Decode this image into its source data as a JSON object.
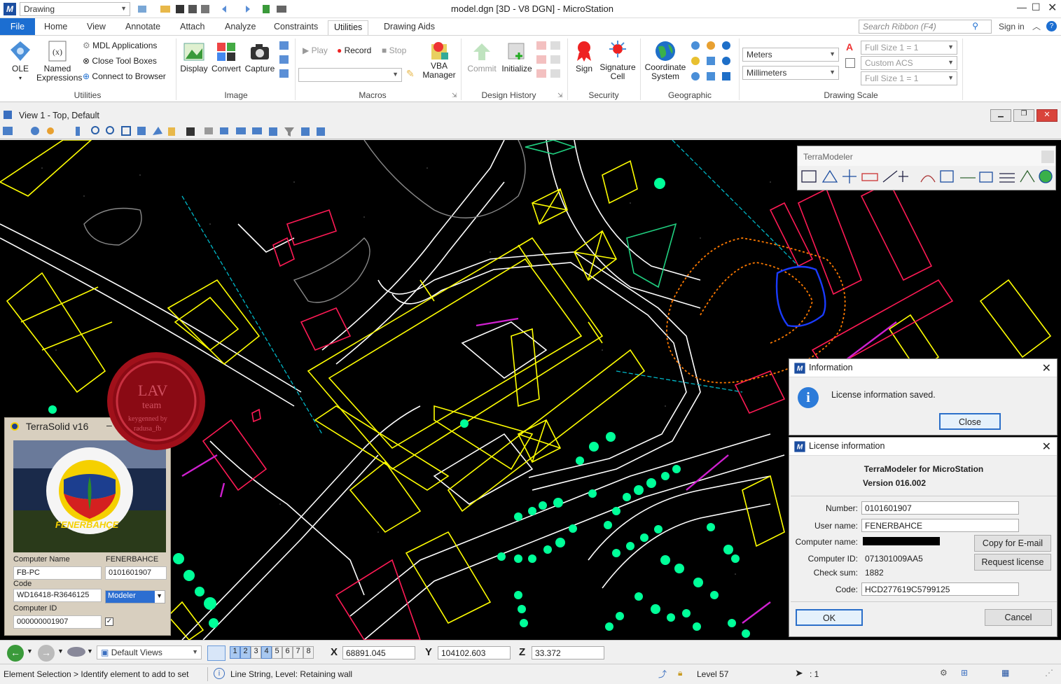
{
  "app": {
    "title": "model.dgn [3D - V8 DGN] - MicroStation",
    "workflow": "Drawing",
    "search_placeholder": "Search Ribbon (F4)",
    "sign_in": "Sign in"
  },
  "tabs": [
    "File",
    "Home",
    "View",
    "Annotate",
    "Attach",
    "Analyze",
    "Constraints",
    "Utilities",
    "Drawing Aids"
  ],
  "ribbon": {
    "utilities": {
      "ole": "OLE",
      "named": "Named",
      "expressions": "Expressions",
      "mdl": "MDL Applications",
      "close_tool": "Close Tool Boxes",
      "connect": "Connect to Browser",
      "label": "Utilities"
    },
    "image": {
      "display": "Display",
      "convert": "Convert",
      "capture": "Capture",
      "label": "Image"
    },
    "macros": {
      "play": "Play",
      "record": "Record",
      "stop": "Stop",
      "vba1": "VBA",
      "vba2": "Manager",
      "label": "Macros"
    },
    "design_history": {
      "commit": "Commit",
      "initialize": "Initialize",
      "label": "Design History"
    },
    "security": {
      "sign": "Sign",
      "sig1": "Signature",
      "sig2": "Cell",
      "label": "Security"
    },
    "geographic": {
      "coord1": "Coordinate",
      "coord2": "System",
      "label": "Geographic"
    },
    "drawing_scale": {
      "unit1": "Meters",
      "unit2": "Millimeters",
      "s1": "Full Size 1 = 1",
      "s2": "Custom ACS",
      "s3": "Full Size 1 = 1",
      "label": "Drawing Scale"
    }
  },
  "view": {
    "title": "View 1 - Top, Default"
  },
  "terramodeler_toolbar": {
    "title": "TerraModeler"
  },
  "info_dialog": {
    "title": "Information",
    "message": "License information saved.",
    "close": "Close"
  },
  "license_dialog": {
    "title": "License information",
    "product": "TerraModeler for MicroStation",
    "version": "Version 016.002",
    "number_label": "Number:",
    "number": "0101601907",
    "user_label": "User name:",
    "user": "FENERBAHCE",
    "computer_label": "Computer name:",
    "computer_id_label": "Computer ID:",
    "computer_id": "071301009AA5",
    "checksum_label": "Check sum:",
    "checksum": "1882",
    "code_label": "Code:",
    "code": "HCD277619C5799125",
    "copy_email": "Copy for E-mail",
    "request": "Request license",
    "ok": "OK",
    "cancel": "Cancel"
  },
  "terrasolid": {
    "title": "TerraSolid v16",
    "seal_line1": "LAV",
    "seal_line2": "team",
    "seal_line3": "keygenned by",
    "seal_line4": "radusa_fb",
    "computer_name_label": "Computer Name",
    "computer_name_value": "FENERBAHCE",
    "pc": "FB-PC",
    "pc_num": "0101601907",
    "code_label": "Code",
    "code": "WD16418-R3646125",
    "product": "Modeler",
    "computer_id_label": "Computer ID",
    "computer_id": "000000001907"
  },
  "bottom": {
    "views": "Default Views",
    "view_nums": [
      "1",
      "2",
      "3",
      "4",
      "5",
      "6",
      "7",
      "8"
    ],
    "x_label": "X",
    "x": "68891.045",
    "y_label": "Y",
    "y": "104102.603",
    "z_label": "Z",
    "z": "33.372"
  },
  "status": {
    "prompt": "Element Selection > Identify element to add to set",
    "info": "Line String, Level: Retaining wall",
    "level": "Level 57",
    "count": ": 1"
  },
  "colors": {
    "accent": "#1c6ed1",
    "canvas": "#000000",
    "wall": "#ffff00",
    "tree": "#00ff99",
    "road": "#ffffff"
  }
}
